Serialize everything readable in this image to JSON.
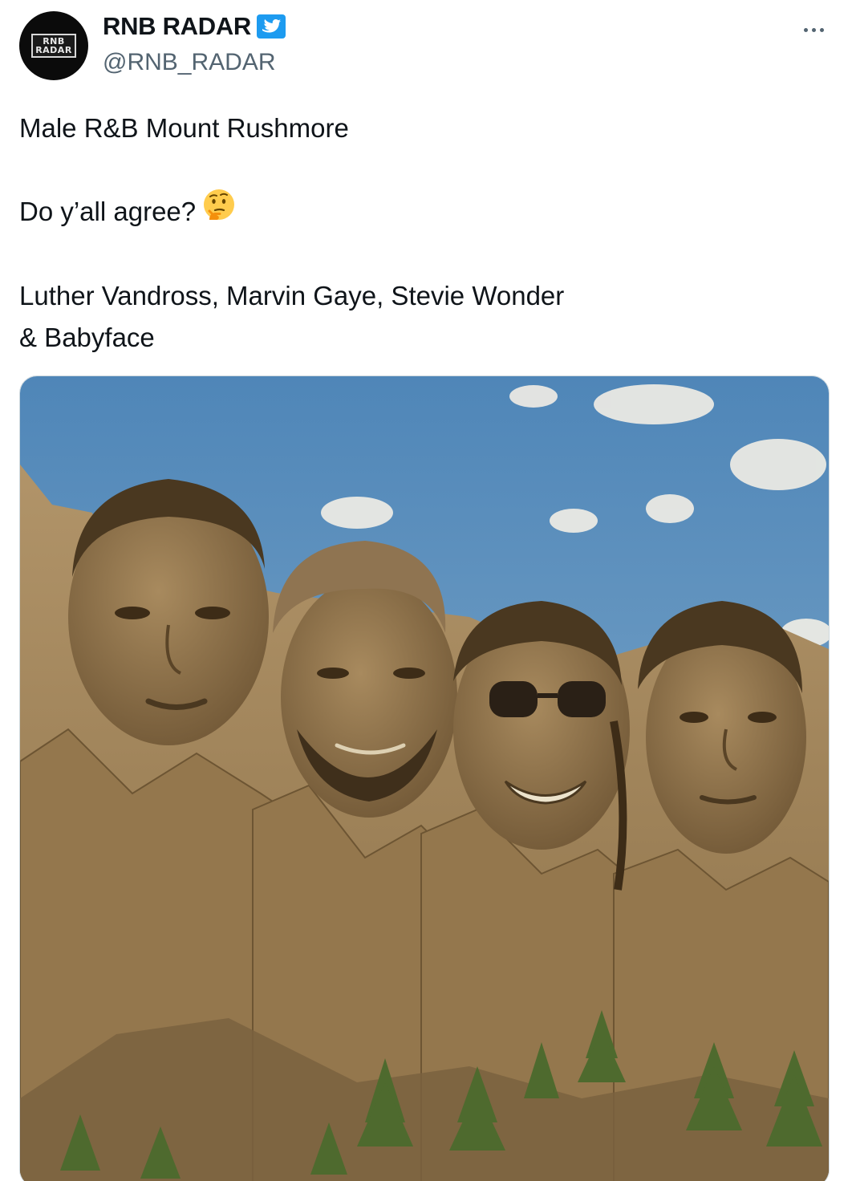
{
  "author": {
    "display_name": "RNB RADAR",
    "handle": "@RNB_RADAR",
    "avatar_text": "RNB\nRADAR",
    "verified_icon": "verified-badge-icon",
    "verified_color": "#1d9bf0"
  },
  "menu": {
    "icon": "more-options-icon"
  },
  "tweet": {
    "line1": "Male R&B Mount Rushmore",
    "line2": "Do y’all agree?",
    "line2_emoji": "thinking-face-emoji",
    "line3": "Luther Vandross, Marvin Gaye, Stevie Wonder & Babyface"
  },
  "media": {
    "kind": "image",
    "subject": "four faces carved into a mountain under a blue sky with clouds, pine trees at the base"
  },
  "colors": {
    "text": "#0f1419",
    "secondary": "#536471",
    "accent": "#1d9bf0",
    "sky": "#5d8fbe",
    "rock": "#a58a5f"
  }
}
